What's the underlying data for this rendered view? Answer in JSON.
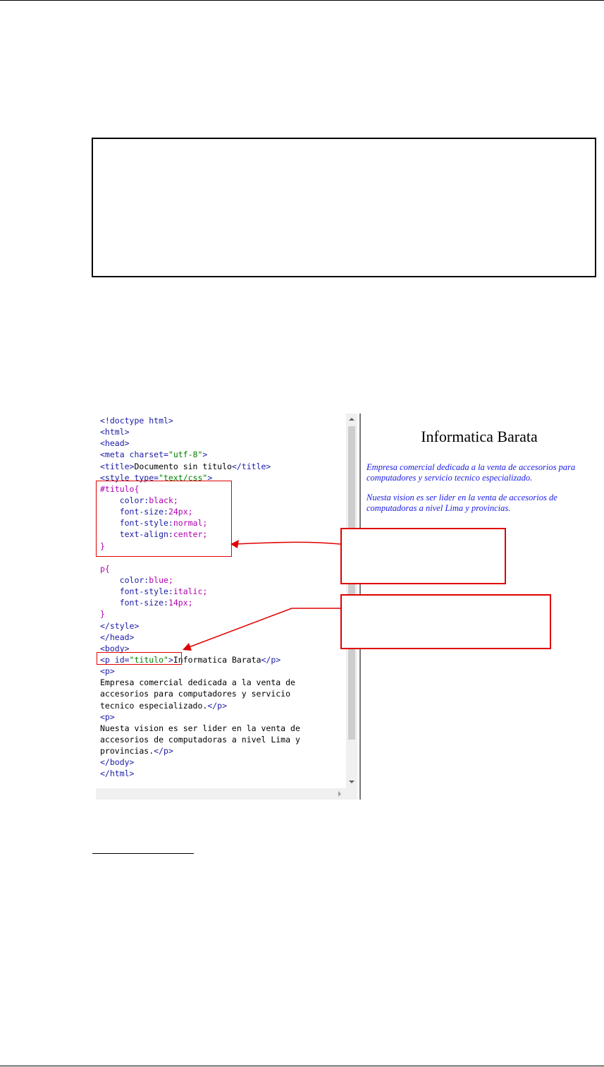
{
  "editor": {
    "lines": [
      [
        {
          "c": "tag",
          "t": "<!doctype html>"
        }
      ],
      [
        {
          "c": "tag",
          "t": "<html>"
        }
      ],
      [
        {
          "c": "tag",
          "t": "<head>"
        }
      ],
      [
        {
          "c": "tag",
          "t": "<meta charset="
        },
        {
          "c": "val",
          "t": "\"utf-8\""
        },
        {
          "c": "tag",
          "t": ">"
        }
      ],
      [
        {
          "c": "tag",
          "t": "<title>"
        },
        {
          "c": "txt",
          "t": "Documento sin titulo"
        },
        {
          "c": "tag",
          "t": "</title>"
        }
      ],
      [
        {
          "c": "tag",
          "t": "<style type="
        },
        {
          "c": "val",
          "t": "\"text/css\""
        },
        {
          "c": "tag",
          "t": ">"
        }
      ],
      [
        {
          "c": "sel",
          "t": "#titulo{"
        }
      ],
      [
        {
          "c": "prop",
          "t": "    color:"
        },
        {
          "c": "pv",
          "t": "black;"
        }
      ],
      [
        {
          "c": "prop",
          "t": "    font-size:"
        },
        {
          "c": "pv",
          "t": "24px;"
        }
      ],
      [
        {
          "c": "prop",
          "t": "    font-style:"
        },
        {
          "c": "pv",
          "t": "normal;"
        }
      ],
      [
        {
          "c": "prop",
          "t": "    text-align:"
        },
        {
          "c": "pv",
          "t": "center;"
        }
      ],
      [
        {
          "c": "sel",
          "t": "}"
        }
      ],
      [
        {
          "c": "txt",
          "t": ""
        }
      ],
      [
        {
          "c": "sel",
          "t": "p{"
        }
      ],
      [
        {
          "c": "prop",
          "t": "    color:"
        },
        {
          "c": "pv",
          "t": "blue;"
        }
      ],
      [
        {
          "c": "prop",
          "t": "    font-style:"
        },
        {
          "c": "pv",
          "t": "italic;"
        }
      ],
      [
        {
          "c": "prop",
          "t": "    font-size:"
        },
        {
          "c": "pv",
          "t": "14px;"
        }
      ],
      [
        {
          "c": "sel",
          "t": "}"
        }
      ],
      [
        {
          "c": "tag",
          "t": "</style>"
        }
      ],
      [
        {
          "c": "tag",
          "t": "</head>"
        }
      ],
      [
        {
          "c": "tag",
          "t": "<body>"
        }
      ],
      [
        {
          "c": "tag",
          "t": "<p id="
        },
        {
          "c": "val",
          "t": "\"titulo\""
        },
        {
          "c": "tag",
          "t": ">"
        },
        {
          "c": "txt",
          "t": "Informatica Barata"
        },
        {
          "c": "tag",
          "t": "</p>"
        }
      ],
      [
        {
          "c": "tag",
          "t": "<p>"
        }
      ],
      [
        {
          "c": "txt",
          "t": "Empresa comercial dedicada a la venta de"
        }
      ],
      [
        {
          "c": "txt",
          "t": "accesorios para computadores y servicio"
        }
      ],
      [
        {
          "c": "txt",
          "t": "tecnico especializado."
        },
        {
          "c": "tag",
          "t": "</p>"
        }
      ],
      [
        {
          "c": "tag",
          "t": "<p>"
        }
      ],
      [
        {
          "c": "txt",
          "t": "Nuesta vision es ser lider en la venta de"
        }
      ],
      [
        {
          "c": "txt",
          "t": "accesorios de computadoras a nivel Lima y"
        }
      ],
      [
        {
          "c": "txt",
          "t": "provincias."
        },
        {
          "c": "tag",
          "t": "</p>"
        }
      ],
      [
        {
          "c": "tag",
          "t": "</body>"
        }
      ],
      [
        {
          "c": "tag",
          "t": "</html>"
        }
      ]
    ]
  },
  "preview": {
    "title": "Informatica Barata",
    "paragraph1": "Empresa comercial dedicada a la venta de accesorios para computadores y servicio tecnico especializado.",
    "paragraph2": "Nuesta vision es ser lider en la venta de accesorios de computadoras a nivel Lima y provincias."
  },
  "colors": {
    "tag": "#1a1aa6",
    "value": "#008000",
    "selector": "#b000b0",
    "annotation": "#e00000",
    "preview_text": "#1a1ae6"
  }
}
